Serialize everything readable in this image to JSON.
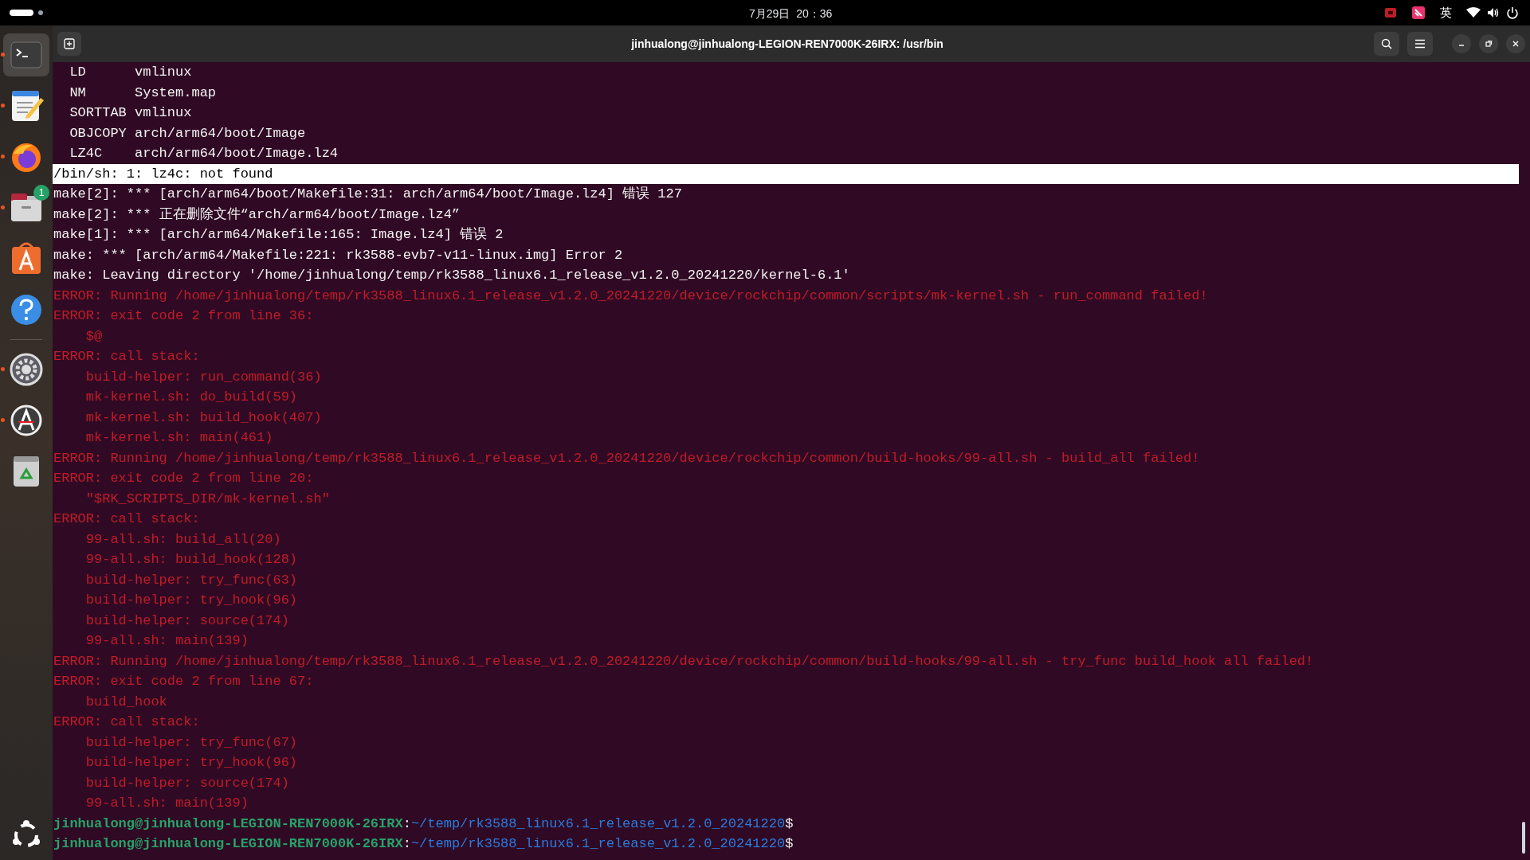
{
  "top_bar": {
    "clock": "7月29日  20：36",
    "input_method": "英"
  },
  "dock": {
    "items": [
      {
        "kind": "terminal",
        "selected": true,
        "running": true
      },
      {
        "kind": "editor",
        "selected": false,
        "running": true
      },
      {
        "kind": "browser",
        "selected": false,
        "running": true
      },
      {
        "kind": "files",
        "selected": false,
        "running": true,
        "badge": "1"
      },
      {
        "kind": "store",
        "selected": false,
        "running": false
      },
      {
        "kind": "help",
        "selected": false,
        "running": false
      },
      {
        "kind": "separator"
      },
      {
        "kind": "settings",
        "selected": false,
        "running": true
      },
      {
        "kind": "updater",
        "selected": false,
        "running": true
      },
      {
        "kind": "trash",
        "selected": false,
        "running": false
      }
    ]
  },
  "terminal": {
    "title": "jinhualong@jinhualong-LEGION-REN7000K-26IRX: /usr/bin",
    "lines": [
      {
        "kind": "normal",
        "text": "  LD      vmlinux"
      },
      {
        "kind": "normal",
        "text": "  NM      System.map"
      },
      {
        "kind": "normal",
        "text": "  SORTTAB vmlinux"
      },
      {
        "kind": "normal",
        "text": "  OBJCOPY arch/arm64/boot/Image"
      },
      {
        "kind": "normal",
        "text": "  LZ4C    arch/arm64/boot/Image.lz4"
      },
      {
        "kind": "highlight",
        "text": "/bin/sh: 1: lz4c: not found"
      },
      {
        "kind": "normal",
        "text": "make[2]: *** [arch/arm64/boot/Makefile:31: arch/arm64/boot/Image.lz4] 错误 127"
      },
      {
        "kind": "normal",
        "text": "make[2]: *** 正在删除文件“arch/arm64/boot/Image.lz4”"
      },
      {
        "kind": "normal",
        "text": "make[1]: *** [arch/arm64/Makefile:165: Image.lz4] 错误 2"
      },
      {
        "kind": "normal",
        "text": "make: *** [arch/arm64/Makefile:221: rk3588-evb7-v11-linux.img] Error 2"
      },
      {
        "kind": "normal",
        "text": "make: Leaving directory '/home/jinhualong/temp/rk3588_linux6.1_release_v1.2.0_20241220/kernel-6.1'"
      },
      {
        "kind": "error",
        "text": "ERROR: Running /home/jinhualong/temp/rk3588_linux6.1_release_v1.2.0_20241220/device/rockchip/common/scripts/mk-kernel.sh - run_command failed!"
      },
      {
        "kind": "error",
        "text": "ERROR: exit code 2 from line 36:"
      },
      {
        "kind": "error",
        "text": "    $@"
      },
      {
        "kind": "error",
        "text": "ERROR: call stack:"
      },
      {
        "kind": "error",
        "text": "    build-helper: run_command(36)"
      },
      {
        "kind": "error",
        "text": "    mk-kernel.sh: do_build(59)"
      },
      {
        "kind": "error",
        "text": "    mk-kernel.sh: build_hook(407)"
      },
      {
        "kind": "error",
        "text": "    mk-kernel.sh: main(461)"
      },
      {
        "kind": "error",
        "text": "ERROR: Running /home/jinhualong/temp/rk3588_linux6.1_release_v1.2.0_20241220/device/rockchip/common/build-hooks/99-all.sh - build_all failed!"
      },
      {
        "kind": "error",
        "text": "ERROR: exit code 2 from line 20:"
      },
      {
        "kind": "error",
        "text": "    \"$RK_SCRIPTS_DIR/mk-kernel.sh\""
      },
      {
        "kind": "error",
        "text": "ERROR: call stack:"
      },
      {
        "kind": "error",
        "text": "    99-all.sh: build_all(20)"
      },
      {
        "kind": "error",
        "text": "    99-all.sh: build_hook(128)"
      },
      {
        "kind": "error",
        "text": "    build-helper: try_func(63)"
      },
      {
        "kind": "error",
        "text": "    build-helper: try_hook(96)"
      },
      {
        "kind": "error",
        "text": "    build-helper: source(174)"
      },
      {
        "kind": "error",
        "text": "    99-all.sh: main(139)"
      },
      {
        "kind": "error",
        "text": "ERROR: Running /home/jinhualong/temp/rk3588_linux6.1_release_v1.2.0_20241220/device/rockchip/common/build-hooks/99-all.sh - try_func build_hook all failed!"
      },
      {
        "kind": "error",
        "text": "ERROR: exit code 2 from line 67:"
      },
      {
        "kind": "error",
        "text": "    build_hook"
      },
      {
        "kind": "error",
        "text": "ERROR: call stack:"
      },
      {
        "kind": "error",
        "text": "    build-helper: try_func(67)"
      },
      {
        "kind": "error",
        "text": "    build-helper: try_hook(96)"
      },
      {
        "kind": "error",
        "text": "    build-helper: source(174)"
      },
      {
        "kind": "error",
        "text": "    99-all.sh: main(139)"
      },
      {
        "kind": "prompt",
        "user": "jinhualong@jinhualong-LEGION-REN7000K-26IRX",
        "sep": ":",
        "path": "~/temp/rk3588_linux6.1_release_v1.2.0_20241220",
        "symbol": "$"
      },
      {
        "kind": "prompt",
        "user": "jinhualong@jinhualong-LEGION-REN7000K-26IRX",
        "sep": ":",
        "path": "~/temp/rk3588_linux6.1_release_v1.2.0_20241220",
        "symbol": "$"
      }
    ]
  }
}
